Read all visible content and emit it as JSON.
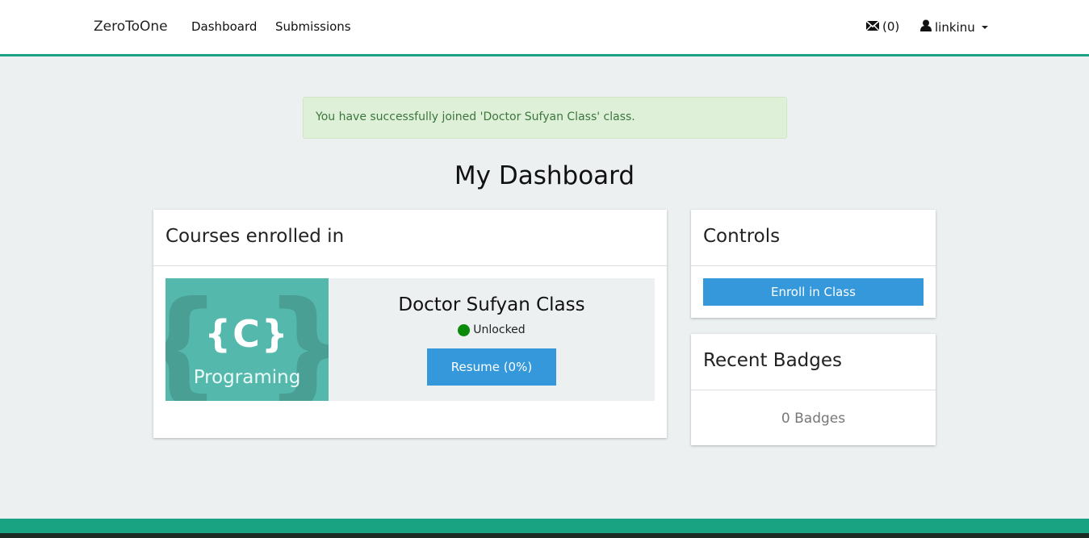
{
  "navbar": {
    "brand": "ZeroToOne",
    "links": [
      {
        "label": "Dashboard"
      },
      {
        "label": "Submissions"
      }
    ],
    "messages": {
      "icon": "envelope-icon",
      "count": "(0)"
    },
    "user": {
      "icon": "user-icon",
      "name": "linkinu"
    }
  },
  "alert": {
    "text": "You have successfully joined 'Doctor Sufyan Class' class."
  },
  "page_title": "My Dashboard",
  "courses_panel": {
    "heading": "Courses enrolled in",
    "courses": [
      {
        "thumbnail_text": "Programing",
        "thumbnail_logo": "{C}",
        "title": "Doctor Sufyan Class",
        "status": "Unlocked",
        "status_color": "#0a8a0a",
        "button_label": "Resume (0%)"
      }
    ]
  },
  "controls_panel": {
    "heading": "Controls",
    "enroll_label": "Enroll in Class"
  },
  "badges_panel": {
    "heading": "Recent Badges",
    "count_text": "0 Badges"
  },
  "colors": {
    "accent": "#1aa383",
    "primary_button": "#3498db",
    "alert_bg": "#dff0d8",
    "thumbnail_bg": "#55b8ad"
  }
}
